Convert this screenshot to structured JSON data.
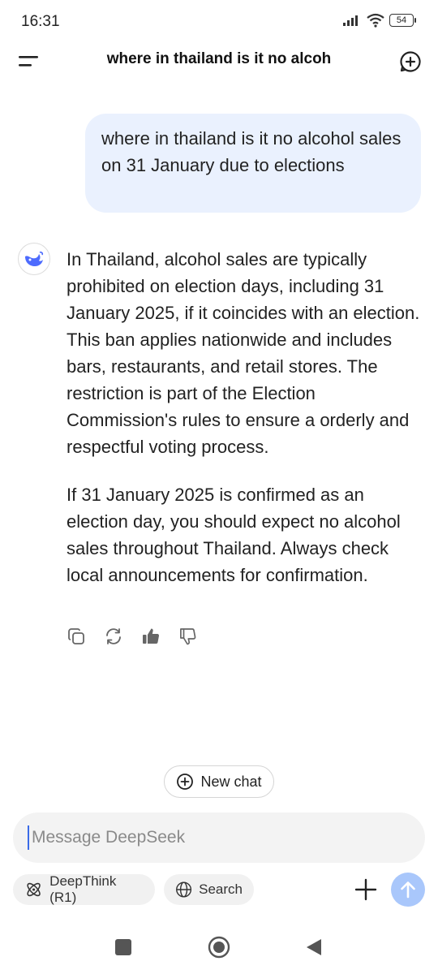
{
  "status_bar": {
    "time": "16:31",
    "battery": "54",
    "icons": [
      "signal-icon",
      "wifi-icon",
      "battery-icon"
    ]
  },
  "header": {
    "title": "where in thailand is it no alcoh",
    "menu_icon": "menu-icon",
    "new_chat_icon": "new-chat-icon"
  },
  "conversation": {
    "user_message": "where in thailand is it no alcohol sales on 31 January due to elections",
    "assistant_paragraphs": [
      "In Thailand, alcohol sales are typically prohibited on election days, including 31 January 2025, if it coincides with an election. This ban applies nationwide and includes bars, restaurants, and retail stores. The restriction is part of the Election Commission's rules to ensure a orderly and respectful voting process.",
      "If 31 January 2025 is confirmed as an election day, you should expect no alcohol sales throughout Thailand. Always check local announcements for confirmation."
    ],
    "actions": [
      "copy-icon",
      "regenerate-icon",
      "thumbs-up-icon",
      "thumbs-down-icon"
    ]
  },
  "new_chat_button": {
    "label": "New chat"
  },
  "composer": {
    "placeholder": "Message DeepSeek",
    "value": "",
    "deepthink_label": "DeepThink (R1)",
    "search_label": "Search",
    "send_color": "#a9c7fb"
  },
  "colors": {
    "accent": "#4d6bfe",
    "user_bubble": "#eaf1fe"
  }
}
